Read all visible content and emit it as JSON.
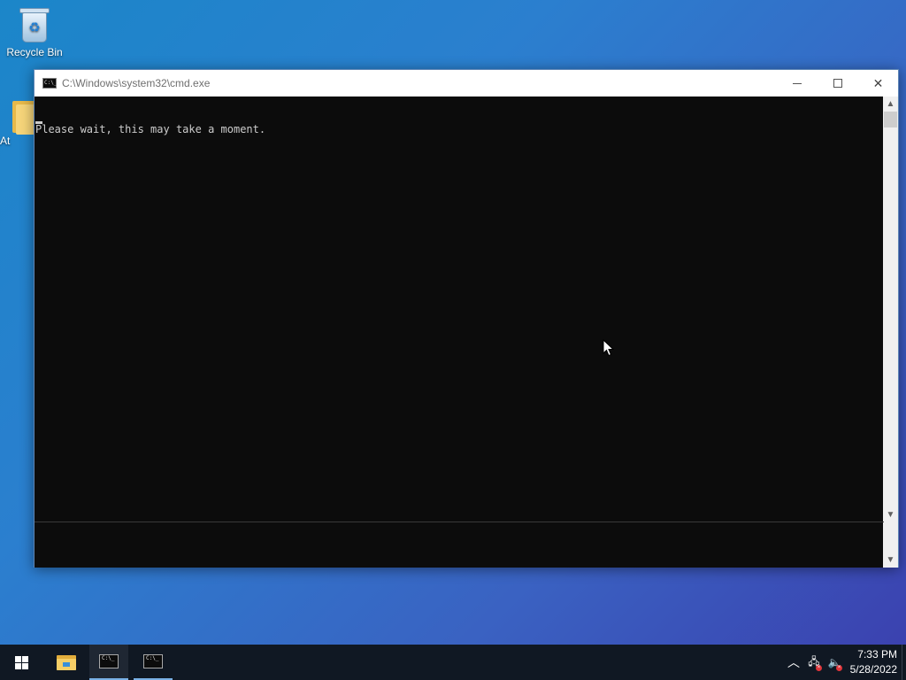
{
  "desktop": {
    "icons": [
      {
        "label": "Recycle Bin",
        "icon": "recycle-bin-icon"
      },
      {
        "label": "At",
        "icon": "folder-icon"
      }
    ]
  },
  "window": {
    "title": "C:\\Windows\\system32\\cmd.exe",
    "icon": "cmd-icon",
    "icon_glyph": "C:\\_",
    "controls": {
      "minimize": "minimize-icon",
      "maximize": "maximize-icon",
      "close": "close-icon",
      "close_glyph": "✕"
    },
    "console": {
      "lines": [
        "Please wait, this may take a moment."
      ]
    },
    "scrollbar": {
      "up_glyph": "▲",
      "down_glyph": "▼"
    }
  },
  "taskbar": {
    "start": "windows-logo-icon",
    "items": [
      {
        "name": "File Explorer",
        "icon": "folder-icon"
      },
      {
        "name": "cmd",
        "icon": "cmd-icon"
      },
      {
        "name": "cmd",
        "icon": "cmd-icon"
      }
    ],
    "tray": {
      "chevron_glyph": "︿",
      "network_glyph": "🖧",
      "volume_glyph": "🔈",
      "error_glyph": "×"
    },
    "clock": {
      "time": "7:33 PM",
      "date": "5/28/2022"
    }
  },
  "colors": {
    "console_bg": "#0c0c0c",
    "console_fg": "#cccccc",
    "taskbar_bg": "#101823",
    "titlebar_bg": "#ffffff"
  }
}
